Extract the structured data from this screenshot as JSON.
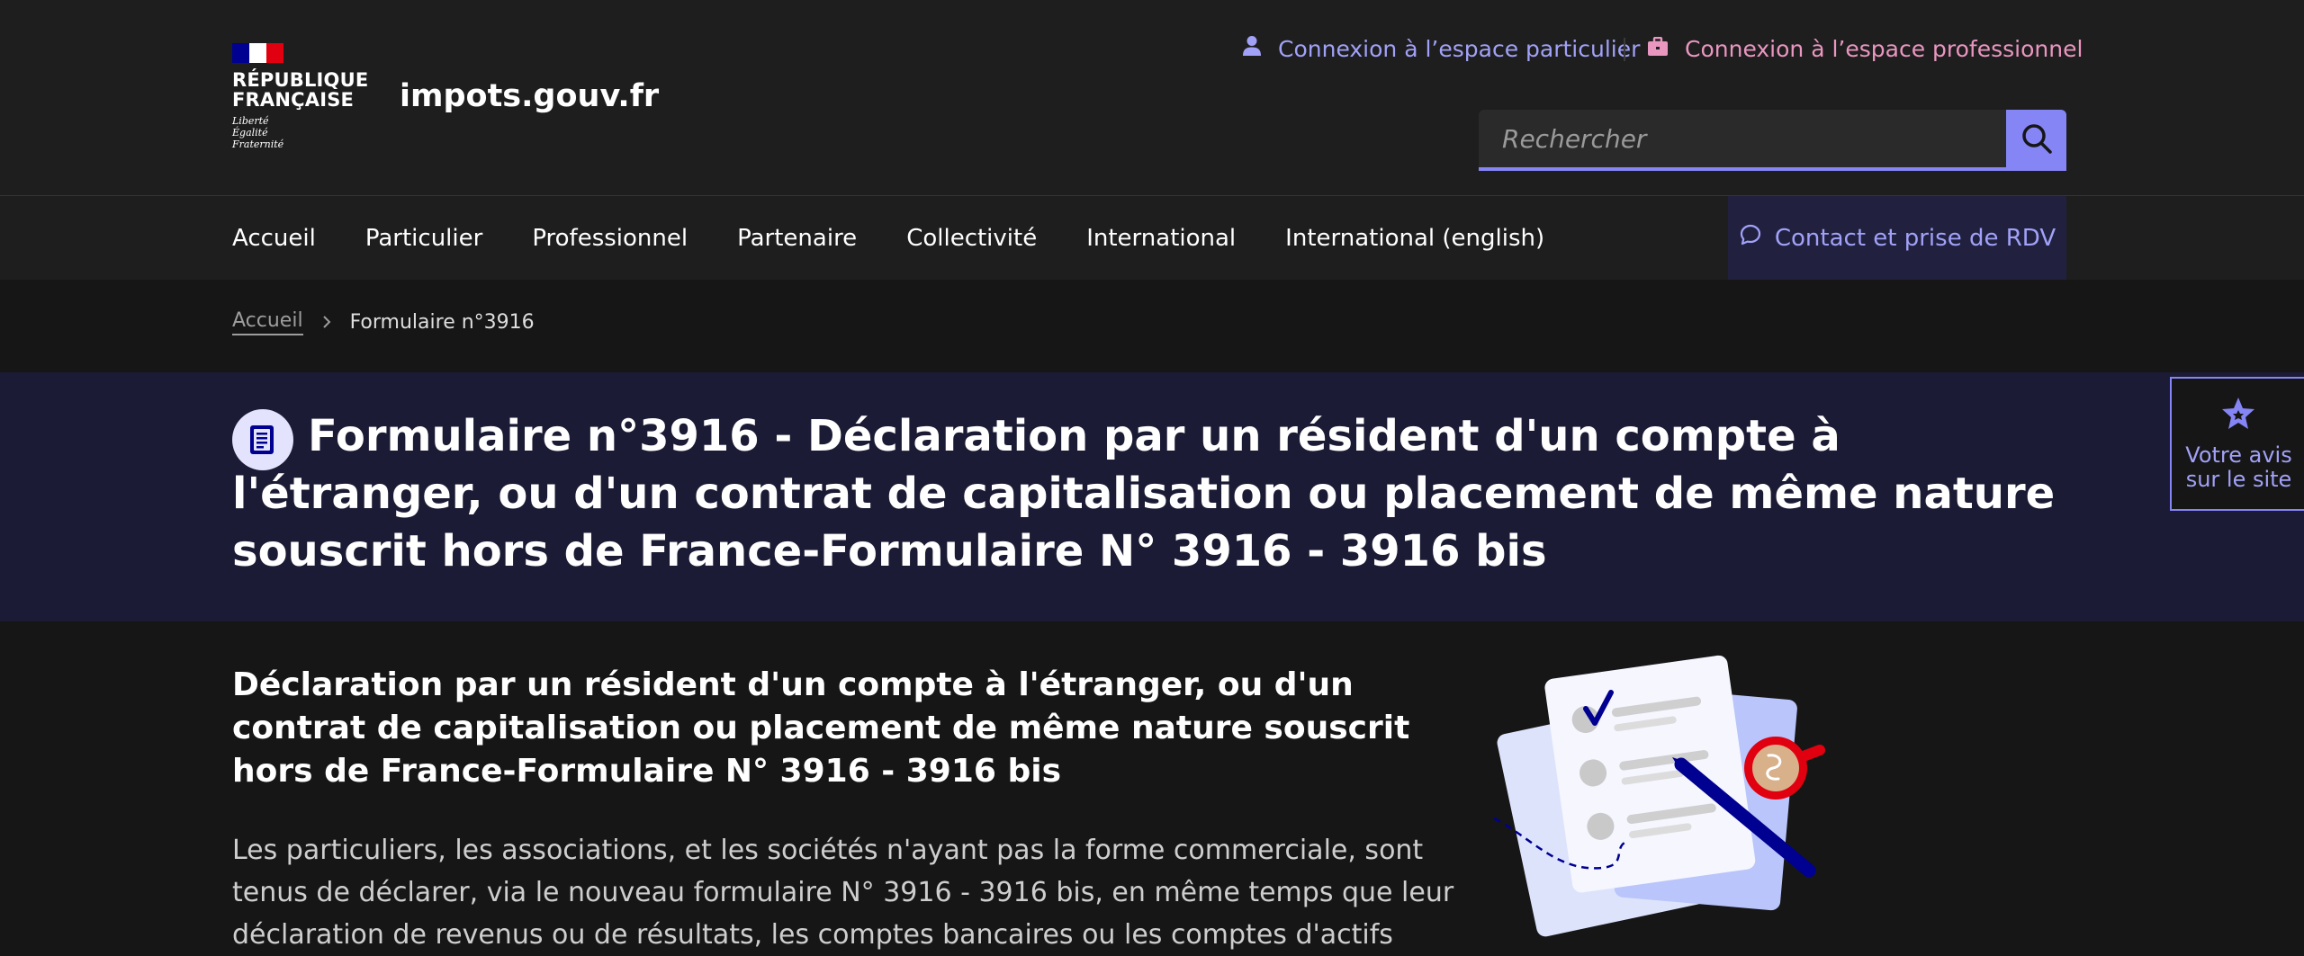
{
  "header": {
    "republic_name_line1": "RÉPUBLIQUE",
    "republic_name_line2": "FRANÇAISE",
    "motto_line1": "Liberté",
    "motto_line2": "Égalité",
    "motto_line3": "Fraternité",
    "site_name": "impots.gouv.fr",
    "link_particulier": "Connexion à l’espace particulier",
    "link_professionnel": "Connexion à l’espace professionnel",
    "search_placeholder": "Rechercher"
  },
  "nav": {
    "items": [
      {
        "label": "Accueil"
      },
      {
        "label": "Particulier"
      },
      {
        "label": "Professionnel"
      },
      {
        "label": "Partenaire"
      },
      {
        "label": "Collectivité"
      },
      {
        "label": "International"
      },
      {
        "label": "International (english)"
      }
    ],
    "contact_label": "Contact et prise de RDV"
  },
  "breadcrumb": {
    "home": "Accueil",
    "current": "Formulaire n°3916"
  },
  "hero": {
    "title": "Formulaire n°3916 - Déclaration par un résident d'un compte à l'étranger, ou d'un contrat de capitalisation ou placement de même nature souscrit hors de France-Formulaire N° 3916 - 3916 bis"
  },
  "feedback": {
    "line1": "Votre avis",
    "line2": "sur le site"
  },
  "content": {
    "title": "Déclaration par un résident d'un compte à l'étranger, ou d'un contrat de capitalisation ou placement de même nature souscrit hors de France-Formulaire N° 3916 - 3916 bis",
    "paragraph": "Les particuliers, les associations, et les sociétés n'ayant pas la forme commerciale, sont tenus de déclarer, via le nouveau formulaire N° 3916 - 3916 bis, en même temps que leur déclaration de revenus ou de résultats, les comptes bancaires ou les comptes d'actifs"
  },
  "colors": {
    "accent": "#8585f6",
    "accent_text": "#a1a1f8",
    "pro_link": "#e996c0",
    "hero_bg": "#1b1b35",
    "page_bg": "#161616",
    "header_bg": "#1e1e1e"
  },
  "icons": {
    "particulier": "user-icon",
    "professionnel": "briefcase-icon",
    "search": "search-icon",
    "contact": "chat-bubble-icon",
    "breadcrumb_sep": "chevron-right-icon",
    "hero": "document-icon",
    "feedback": "star-icon"
  }
}
